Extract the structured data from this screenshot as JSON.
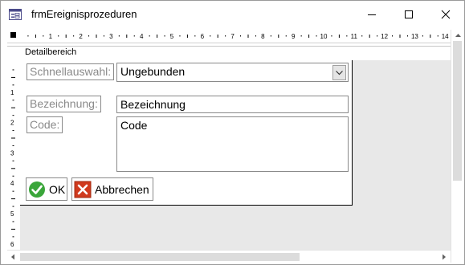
{
  "window": {
    "title": "frmEreignisprozeduren"
  },
  "ruler": {
    "h_ticks": [
      "1",
      "2",
      "3",
      "4",
      "5",
      "6",
      "7",
      "8",
      "9",
      "10",
      "11",
      "12",
      "13",
      "14"
    ],
    "v_ticks": [
      "1",
      "2",
      "3",
      "4",
      "5",
      "6"
    ]
  },
  "section": {
    "label": "Detailbereich"
  },
  "form": {
    "schnellauswahl_label": "Schnellauswahl:",
    "schnellauswahl_value": "Ungebunden",
    "bezeichnung_label": "Bezeichnung:",
    "bezeichnung_value": "Bezeichnung",
    "code_label": "Code:",
    "code_value": "Code",
    "ok_label": "OK",
    "cancel_label": "Abbrechen"
  }
}
